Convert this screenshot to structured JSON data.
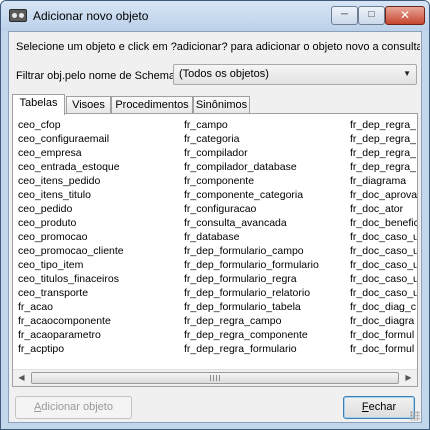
{
  "window": {
    "title": "Adicionar novo objeto",
    "controls": {
      "minimize_icon": "minimize-icon",
      "maximize_icon": "maximize-icon",
      "close_icon": "close-icon"
    }
  },
  "instruction": "Selecione um objeto e click em  ?adicionar? para adicionar o objeto novo a consulta",
  "filter": {
    "label": "Filtrar obj.pelo nome de Schema",
    "selected": "(Todos os objetos)"
  },
  "tabs": [
    {
      "label": "Tabelas",
      "active": true
    },
    {
      "label": "Visoes",
      "active": false
    },
    {
      "label": "Procedimentos",
      "active": false
    },
    {
      "label": "Sinônimos",
      "active": false
    }
  ],
  "list": {
    "columns": [
      [
        "ceo_cfop",
        "ceo_configuraemail",
        "ceo_empresa",
        "ceo_entrada_estoque",
        "ceo_itens_pedido",
        "ceo_itens_titulo",
        "ceo_pedido",
        "ceo_produto",
        "ceo_promocao",
        "ceo_promocao_cliente",
        "ceo_tipo_item",
        "ceo_titulos_finaceiros",
        "ceo_transporte",
        "fr_acao",
        "fr_acaocomponente",
        "fr_acaoparametro",
        "fr_acptipo"
      ],
      [
        "fr_campo",
        "fr_categoria",
        "fr_compilador",
        "fr_compilador_database",
        "fr_componente",
        "fr_componente_categoria",
        "fr_configuracao",
        "fr_consulta_avancada",
        "fr_database",
        "fr_dep_formulario_campo",
        "fr_dep_formulario_formulario",
        "fr_dep_formulario_regra",
        "fr_dep_formulario_relatorio",
        "fr_dep_formulario_tabela",
        "fr_dep_regra_campo",
        "fr_dep_regra_componente",
        "fr_dep_regra_formulario"
      ],
      [
        "fr_dep_regra_",
        "fr_dep_regra_",
        "fr_dep_regra_",
        "fr_dep_regra_",
        "fr_diagrama",
        "fr_doc_aprova",
        "fr_doc_ator",
        "fr_doc_benefic",
        "fr_doc_caso_u",
        "fr_doc_caso_u",
        "fr_doc_caso_u",
        "fr_doc_caso_u",
        "fr_doc_caso_u",
        "fr_doc_diag_c",
        "fr_doc_diagra",
        "fr_doc_formul",
        "fr_doc_formul"
      ]
    ]
  },
  "scrollbar": {
    "left_icon": "scroll-left-icon",
    "right_icon": "scroll-right-icon"
  },
  "buttons": {
    "add_mnemonic": "A",
    "add_rest": "dicionar objeto",
    "close_mnemonic": "F",
    "close_rest": "echar"
  }
}
